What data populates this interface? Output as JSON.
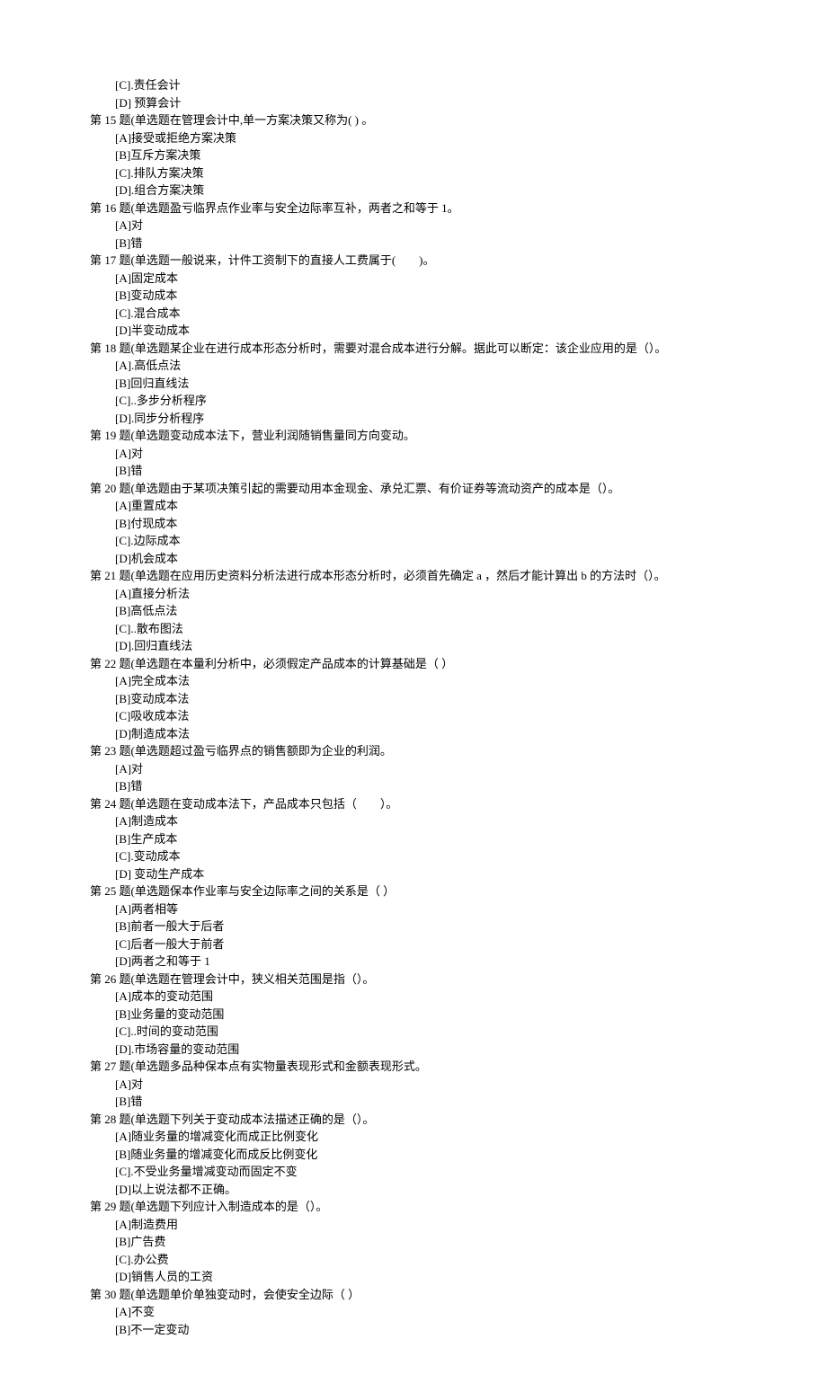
{
  "lines": [
    {
      "cls": "option",
      "text": "[C].责任会计"
    },
    {
      "cls": "option",
      "text": "[D] 预算会计"
    },
    {
      "cls": "question",
      "text": "第 15 题(单选题在管理会计中,单一方案决策又称为( ) 。"
    },
    {
      "cls": "option",
      "text": "[A]接受或拒绝方案决策"
    },
    {
      "cls": "option",
      "text": "[B]互斥方案决策"
    },
    {
      "cls": "option",
      "text": "[C].排队方案决策"
    },
    {
      "cls": "option",
      "text": "[D].组合方案决策"
    },
    {
      "cls": "question",
      "text": "第 16 题(单选题盈亏临界点作业率与安全边际率互补，两者之和等于 1。"
    },
    {
      "cls": "option",
      "text": "[A]对"
    },
    {
      "cls": "option",
      "text": "[B]错"
    },
    {
      "cls": "question",
      "text": "第 17 题(单选题一般说来，计件工资制下的直接人工费属于(　　)。"
    },
    {
      "cls": "option",
      "text": "[A]固定成本"
    },
    {
      "cls": "option",
      "text": "[B]变动成本"
    },
    {
      "cls": "option",
      "text": "[C].混合成本"
    },
    {
      "cls": "option",
      "text": "[D]半变动成本"
    },
    {
      "cls": "question",
      "text": "第 18 题(单选题某企业在进行成本形态分析时，需要对混合成本进行分解。据此可以断定：该企业应用的是（）。"
    },
    {
      "cls": "option",
      "text": "[A].高低点法"
    },
    {
      "cls": "option",
      "text": "[B]回归直线法"
    },
    {
      "cls": "option",
      "text": "[C]..多步分析程序"
    },
    {
      "cls": "option",
      "text": "[D].同步分析程序"
    },
    {
      "cls": "question",
      "text": "第 19 题(单选题变动成本法下，营业利润随销售量同方向变动。"
    },
    {
      "cls": "option",
      "text": "[A]对"
    },
    {
      "cls": "option",
      "text": "[B]错"
    },
    {
      "cls": "question",
      "text": "第 20 题(单选题由于某项决策引起的需要动用本金现金、承兑汇票、有价证券等流动资产的成本是（）。"
    },
    {
      "cls": "option",
      "text": "[A]重置成本"
    },
    {
      "cls": "option",
      "text": "[B]付现成本"
    },
    {
      "cls": "option",
      "text": "[C].边际成本"
    },
    {
      "cls": "option",
      "text": "[D]机会成本"
    },
    {
      "cls": "question",
      "text": "第 21 题(单选题在应用历史资料分析法进行成本形态分析时，必须首先确定 a ，然后才能计算出 b 的方法时（）。"
    },
    {
      "cls": "option",
      "text": "[A]直接分析法"
    },
    {
      "cls": "option",
      "text": "[B]高低点法"
    },
    {
      "cls": "option",
      "text": "[C]..散布图法"
    },
    {
      "cls": "option",
      "text": "[D].回归直线法"
    },
    {
      "cls": "question",
      "text": "第 22 题(单选题在本量利分析中，必须假定产品成本的计算基础是（  ）"
    },
    {
      "cls": "option",
      "text": "[A]完全成本法"
    },
    {
      "cls": "option",
      "text": "[B]变动成本法"
    },
    {
      "cls": "option",
      "text": "[C]吸收成本法"
    },
    {
      "cls": "option",
      "text": "[D]制造成本法"
    },
    {
      "cls": "question",
      "text": "第 23 题(单选题超过盈亏临界点的销售额即为企业的利润。"
    },
    {
      "cls": "option",
      "text": "[A]对"
    },
    {
      "cls": "option",
      "text": "[B]错"
    },
    {
      "cls": "question",
      "text": "第 24 题(单选题在变动成本法下，产品成本只包括（　　）。"
    },
    {
      "cls": "option",
      "text": "[A]制造成本"
    },
    {
      "cls": "option",
      "text": "[B]生产成本"
    },
    {
      "cls": "option",
      "text": "[C].变动成本"
    },
    {
      "cls": "option",
      "text": "[D] 变动生产成本"
    },
    {
      "cls": "question",
      "text": "第 25 题(单选题保本作业率与安全边际率之间的关系是（  ）"
    },
    {
      "cls": "option",
      "text": "[A]两者相等"
    },
    {
      "cls": "option",
      "text": "[B]前者一般大于后者"
    },
    {
      "cls": "option",
      "text": "[C]后者一般大于前者"
    },
    {
      "cls": "option",
      "text": "[D]两者之和等于 1"
    },
    {
      "cls": "question",
      "text": "第 26 题(单选题在管理会计中，狭义相关范围是指（）。"
    },
    {
      "cls": "option",
      "text": "[A]成本的变动范围"
    },
    {
      "cls": "option",
      "text": "[B]业务量的变动范围"
    },
    {
      "cls": "option",
      "text": "[C]..时间的变动范围"
    },
    {
      "cls": "option",
      "text": "[D].市场容量的变动范围"
    },
    {
      "cls": "question",
      "text": "第 27 题(单选题多品种保本点有实物量表现形式和金额表现形式。"
    },
    {
      "cls": "option",
      "text": "[A]对"
    },
    {
      "cls": "option",
      "text": "[B]错"
    },
    {
      "cls": "question",
      "text": "第 28 题(单选题下列关于变动成本法描述正确的是（）。"
    },
    {
      "cls": "option",
      "text": "[A]随业务量的增减变化而成正比例变化"
    },
    {
      "cls": "option",
      "text": "[B]随业务量的增减变化而成反比例变化"
    },
    {
      "cls": "option",
      "text": "[C].不受业务量增减变动而固定不变"
    },
    {
      "cls": "option",
      "text": "[D]以上说法都不正确。"
    },
    {
      "cls": "question",
      "text": "第 29 题(单选题下列应计入制造成本的是（）。"
    },
    {
      "cls": "option",
      "text": "[A]制造费用"
    },
    {
      "cls": "option",
      "text": "[B]广告费"
    },
    {
      "cls": "option",
      "text": "[C].办公费"
    },
    {
      "cls": "option",
      "text": "[D]销售人员的工资"
    },
    {
      "cls": "question",
      "text": "第 30 题(单选题单价单独变动时，会使安全边际（  ）"
    },
    {
      "cls": "option",
      "text": "[A]不变"
    },
    {
      "cls": "option",
      "text": "[B]不一定变动"
    }
  ]
}
